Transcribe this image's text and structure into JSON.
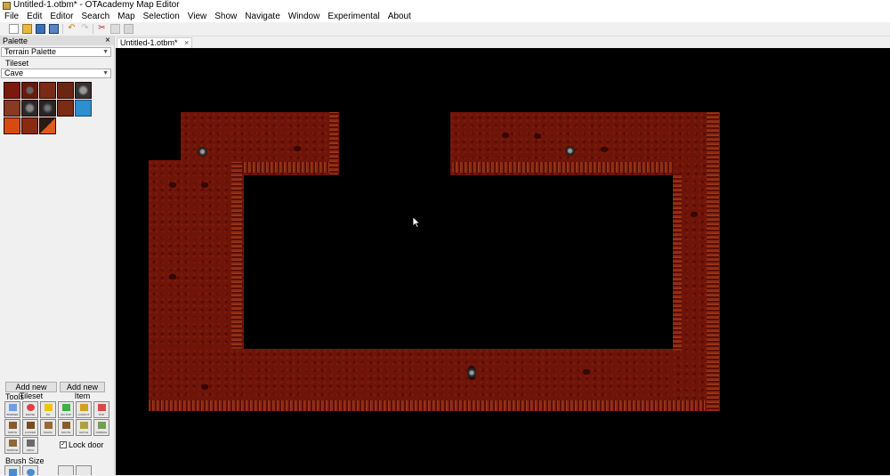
{
  "window": {
    "title": "Untitled-1.otbm* - OTAcademy Map Editor"
  },
  "menu": [
    "File",
    "Edit",
    "Editor",
    "Search",
    "Map",
    "Selection",
    "View",
    "Show",
    "Navigate",
    "Window",
    "Experimental",
    "About"
  ],
  "toolbar": {
    "icons": [
      "new-file-icon",
      "open-folder-icon",
      "save-icon",
      "save-as-icon",
      "undo-icon",
      "redo-icon",
      "cut-icon",
      "copy-icon",
      "paste-icon"
    ]
  },
  "palette": {
    "header": "Palette",
    "close_glyph": "×",
    "palette_type": "Terrain Palette",
    "tileset_label": "Tileset",
    "tileset_value": "Cave",
    "add_tileset_label": "Add new Tileset",
    "add_item_label": "Add new Item",
    "tools_label": "Tools",
    "tools_row1": [
      "BORDER",
      "ERASE",
      "PZ",
      "NO-PVP",
      "LOGOUT",
      "PVP"
    ],
    "tools_row2": [
      "NORTH",
      "LOCKED",
      "MAGIC",
      "SOUTH",
      "HATCH",
      "NORMAL"
    ],
    "tools_row3": [
      "WINDOW",
      "ARCH"
    ],
    "lock_door_label": "Lock door",
    "lock_door_checked": true,
    "brush_size_label": "Brush Size"
  },
  "tabs": [
    {
      "label": "Untitled-1.otbm*",
      "close_glyph": "×"
    }
  ],
  "colors": {
    "canvas_bg": "#000000",
    "cave_floor": "#6e1408",
    "water_tile": "#2b8fd0",
    "lava_tile": "#d84a10"
  }
}
